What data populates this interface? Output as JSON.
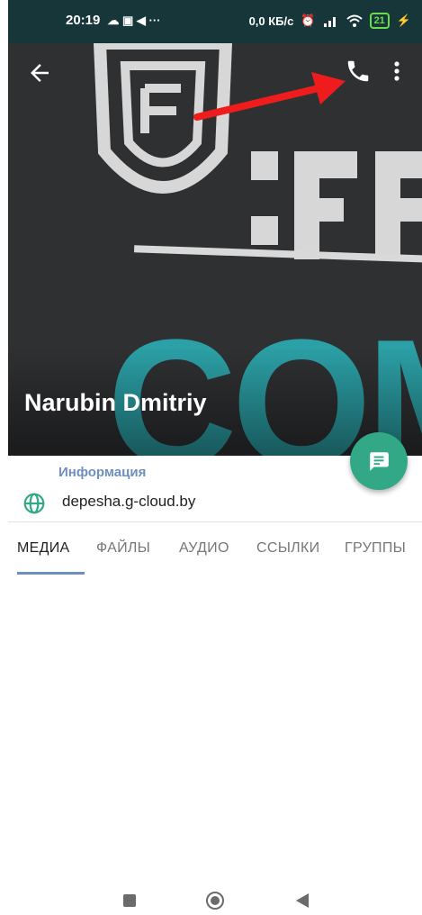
{
  "status_bar": {
    "time": "20:19",
    "left_icons": "☁ ▣ ◀ ···",
    "speed": "0,0 КБ/с",
    "battery": "21"
  },
  "header": {
    "logo_text": "COM",
    "contact_name": "Narubin Dmitriy"
  },
  "info": {
    "title": "Информация",
    "website": "depesha.g-cloud.by"
  },
  "tabs": [
    {
      "label": "МЕДИА"
    },
    {
      "label": "ФАЙЛЫ"
    },
    {
      "label": "АУДИО"
    },
    {
      "label": "ССЫЛКИ"
    },
    {
      "label": "ГРУППЫ"
    }
  ],
  "colors": {
    "accent": "#6f8fc0",
    "fab": "#33a887",
    "arrow": "#ee1c1c",
    "status_bar": "#17363a"
  }
}
